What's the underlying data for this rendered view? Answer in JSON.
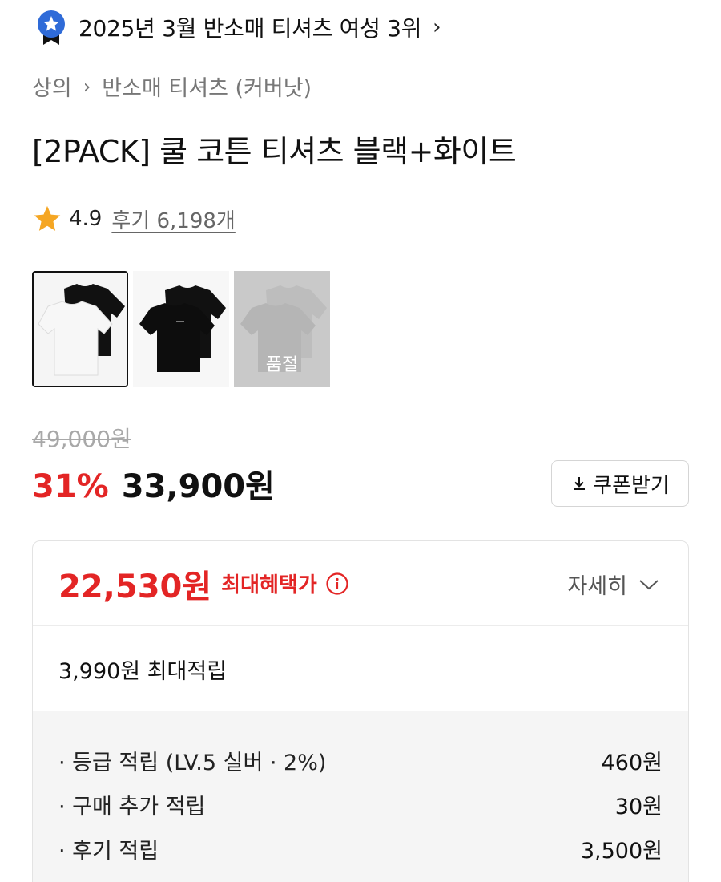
{
  "ranking": {
    "text": "2025년 3월 반소매 티셔츠 여성 3위"
  },
  "breadcrumb": {
    "items": [
      "상의",
      "반소매 티셔츠 (커버낫)"
    ]
  },
  "product": {
    "title": "[2PACK] 쿨 코튼 티셔츠 블랙+화이트"
  },
  "rating": {
    "score": "4.9",
    "reviews": "후기 6,198개"
  },
  "thumbnails": [
    {
      "alt": "black-white-set",
      "selected": true,
      "label": ""
    },
    {
      "alt": "black-black-set",
      "selected": false,
      "label": ""
    },
    {
      "alt": "gray-set",
      "selected": false,
      "label": "품절"
    }
  ],
  "price": {
    "original": "49,000원",
    "discount": "31%",
    "sale": "33,900원"
  },
  "coupon": {
    "label": "쿠폰받기"
  },
  "benefit": {
    "max_price": "22,530원",
    "max_label": "최대혜택가",
    "detail_label": "자세히",
    "points_total": "3,990원 최대적립",
    "items": [
      {
        "label": "· 등급 적립 (LV.5 실버 · 2%)",
        "amount": "460원"
      },
      {
        "label": "· 구매 추가 적립",
        "amount": "30원"
      },
      {
        "label": "· 후기 적립",
        "amount": "3,500원"
      }
    ]
  },
  "colors": {
    "accent_red": "#e32525",
    "badge_blue": "#2f6bd8"
  }
}
